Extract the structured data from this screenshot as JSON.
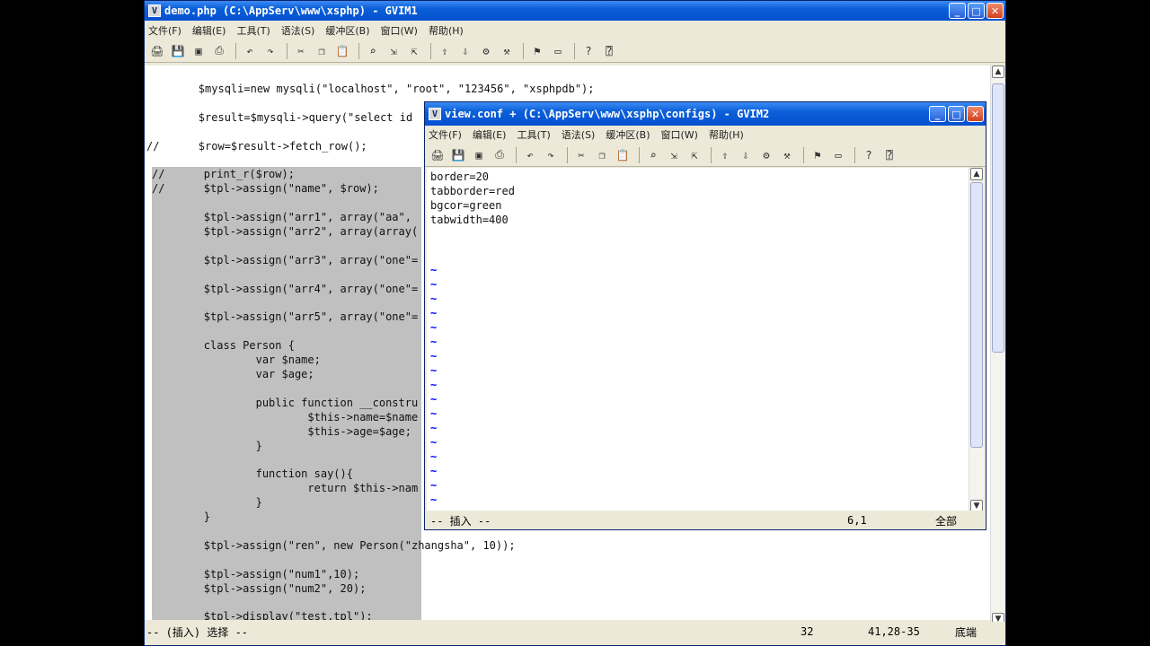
{
  "main_window": {
    "title": "demo.php (C:\\AppServ\\www\\xsphp) - GVIM1",
    "menu": [
      "文件(F)",
      "编辑(E)",
      "工具(T)",
      "语法(S)",
      "缓冲区(B)",
      "窗口(W)",
      "帮助(H)"
    ],
    "code_lines": [
      {
        "text": "        $mysqli=new mysqli(\"localhost\", \"root\", \"123456\", \"xsphpdb\");",
        "sel": false
      },
      {
        "text": "",
        "sel": false
      },
      {
        "text": "        $result=$mysqli->query(\"select id",
        "sel": false
      },
      {
        "text": "",
        "sel": false
      },
      {
        "text": "//      $row=$result->fetch_row();",
        "sel": false
      },
      {
        "text": "",
        "sel": false
      },
      {
        "text": "//      print_r($row);",
        "sel": true
      },
      {
        "text": "//      $tpl->assign(\"name\", $row);",
        "sel": true
      },
      {
        "text": "",
        "sel": true
      },
      {
        "text": "        $tpl->assign(\"arr1\", array(\"aa\", ",
        "sel": true
      },
      {
        "text": "        $tpl->assign(\"arr2\", array(array(",
        "sel": true
      },
      {
        "text": "",
        "sel": true
      },
      {
        "text": "        $tpl->assign(\"arr3\", array(\"one\"=",
        "sel": true
      },
      {
        "text": "",
        "sel": true
      },
      {
        "text": "        $tpl->assign(\"arr4\", array(\"one\"=",
        "sel": true
      },
      {
        "text": "",
        "sel": true
      },
      {
        "text": "        $tpl->assign(\"arr5\", array(\"one\"=",
        "sel": true
      },
      {
        "text": "",
        "sel": true
      },
      {
        "text": "        class Person {",
        "sel": true
      },
      {
        "text": "                var $name;",
        "sel": true
      },
      {
        "text": "                var $age;",
        "sel": true
      },
      {
        "text": "",
        "sel": true
      },
      {
        "text": "                public function __constru",
        "sel": true
      },
      {
        "text": "                        $this->name=$name",
        "sel": true
      },
      {
        "text": "                        $this->age=$age;",
        "sel": true
      },
      {
        "text": "                }",
        "sel": true
      },
      {
        "text": "",
        "sel": true
      },
      {
        "text": "                function say(){",
        "sel": true
      },
      {
        "text": "                        return $this->nam",
        "sel": true
      },
      {
        "text": "                }",
        "sel": true
      },
      {
        "text": "        }",
        "sel": true
      },
      {
        "text": "",
        "sel": true
      },
      {
        "text": "        $tpl->assign(\"ren\", new Person(\"zhangsha\", 10));",
        "sel": true
      },
      {
        "text": "",
        "sel": true
      },
      {
        "text": "        $tpl->assign(\"num1\",10);",
        "sel": true
      },
      {
        "text": "        $tpl->assign(\"num2\", 20);",
        "sel": true
      },
      {
        "text": "",
        "sel": true
      },
      {
        "text": "        $tpl->display(\"test.tpl\");",
        "sel": true
      }
    ],
    "status": {
      "mode": "-- (插入) 选择 --",
      "line": "32",
      "pos": "41,28-35",
      "where": "底端"
    }
  },
  "conf_window": {
    "title": "view.conf + (C:\\AppServ\\www\\xsphp\\configs) - GVIM2",
    "menu": [
      "文件(F)",
      "编辑(E)",
      "工具(T)",
      "语法(S)",
      "缓冲区(B)",
      "窗口(W)",
      "帮助(H)"
    ],
    "lines": [
      "border=20",
      "tabborder=red",
      "bgcor=green",
      "tabwidth=400"
    ],
    "status": {
      "mode": "-- 插入 --",
      "pos": "6,1",
      "where": "全部"
    }
  },
  "toolbar_icons": [
    "open-icon",
    "save-icon",
    "save-all-icon",
    "print-icon",
    "undo-icon",
    "redo-icon",
    "cut-icon",
    "copy-icon",
    "paste-icon",
    "find-icon",
    "find-next-icon",
    "find-prev-icon",
    "load-session-icon",
    "save-session-icon",
    "run-script-icon",
    "make-icon",
    "tag-icon",
    "shell-icon",
    "help-icon",
    "find-help-icon"
  ]
}
